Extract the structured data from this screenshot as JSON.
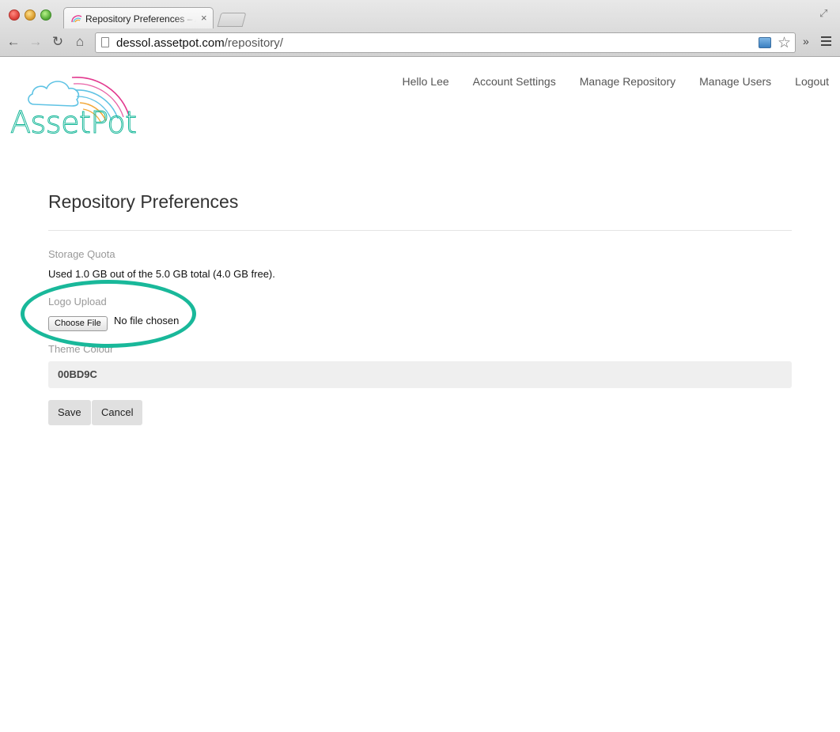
{
  "browser": {
    "tab_title": "Repository Preferences – AssetPot",
    "tab_close": "×",
    "url_host": "dessol.assetpot.com",
    "url_path": "/repository/",
    "more_label": "»"
  },
  "logo": {
    "text": "AssetPot",
    "accent_colors": [
      "#e2388e",
      "#5fc3e4",
      "#f2a93b",
      "#19b89a"
    ]
  },
  "nav": {
    "items": [
      "Hello Lee",
      "Account Settings",
      "Manage Repository",
      "Manage Users",
      "Logout"
    ]
  },
  "page": {
    "title": "Repository Preferences",
    "storage": {
      "label": "Storage Quota",
      "text": "Used 1.0 GB out of the 5.0 GB total (4.0 GB free)."
    },
    "logo_upload": {
      "label": "Logo Upload",
      "button": "Choose File",
      "status": "No file chosen"
    },
    "theme": {
      "label": "Theme Colour",
      "value": "00BD9C"
    },
    "buttons": {
      "save": "Save",
      "cancel": "Cancel"
    }
  },
  "annotation": {
    "highlight_color": "#19b89a"
  }
}
